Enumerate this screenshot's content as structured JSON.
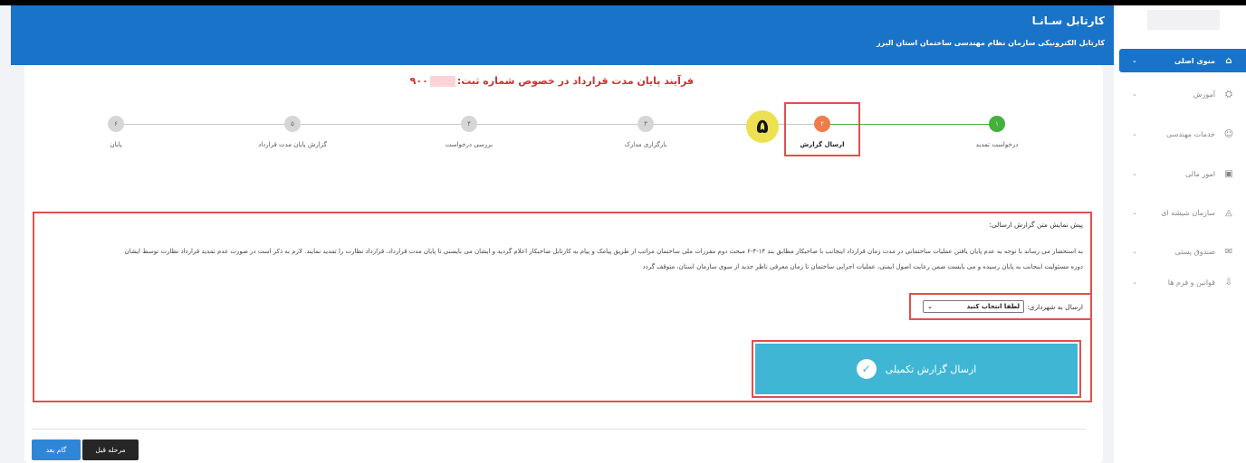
{
  "header": {
    "title": "کارتابل سـانـا",
    "subtitle": "کارتابل الکترونیکی سازمان نظام مهندسی ساختمان استان البرز"
  },
  "sidebar": {
    "items": [
      {
        "label": "منوی اصلی",
        "icon": "home-icon"
      },
      {
        "label": "آموزش",
        "icon": "education-icon"
      },
      {
        "label": "خدمات مهندسی",
        "icon": "engineer-icon"
      },
      {
        "label": "امور مالی",
        "icon": "finance-icon"
      },
      {
        "label": "سازمان شیشه ای",
        "icon": "chart-icon"
      },
      {
        "label": "صندوق پستی",
        "icon": "mailbox-icon"
      },
      {
        "label": "قوانین و فرم ها",
        "icon": "download-icon"
      }
    ]
  },
  "card": {
    "title_prefix": "فرآیند پایان مدت قرارداد در خصوص شماره ثبت:",
    "title_suffix": "۹۰۰"
  },
  "steps": [
    {
      "num": "۱",
      "label": "درخواست تمدید"
    },
    {
      "num": "۲",
      "label": "ارسال گزارش"
    },
    {
      "num": "۳",
      "label": "بارگزاری مدارک"
    },
    {
      "num": "۴",
      "label": "بررسی درخواست"
    },
    {
      "num": "۵",
      "label": "گزارش پایان مدت قرارداد"
    },
    {
      "num": "۶",
      "label": "پایان"
    }
  ],
  "current_step_marker": "۵",
  "preview": {
    "heading": "پیش نمایش متن گزارش ارسالی:",
    "line1": "به استحضار می رساند با توجه به عدم پایان یافتن عملیات ساختمانی در مدت زمان قرارداد اینجانب با صاحبکار مطابق بند ۱۴-۴-۶ مبحث دوم مقررات ملی ساختمان مراتب از طریق پیامک و پیام به کارتابل صاحبکار اعلام گردید و ایشان می بایستی تا پایان مدت قرارداد، قرارداد نظارت را تمدید نمایند. لازم به ذکر است در صورت عدم تمدید قرارداد نظارت توسط ایشان",
    "line2": "دوره مسئولیت اینجانب به پایان رسیده و می بایست ضمن رعایت اصول ایمنی، عملیات اجرایی ساختمان تا زمان معرفی ناظر جدید از سوی سازمان استان، متوقف گردد"
  },
  "municipality": {
    "label": "ارسال به شهرداری:",
    "selected": "لطفا انتخاب کنید"
  },
  "submit": {
    "label": "ارسال گزارش تکمیلی"
  },
  "footer": {
    "prev_label": "مرحله قبل",
    "next_label": "گام بعد"
  }
}
